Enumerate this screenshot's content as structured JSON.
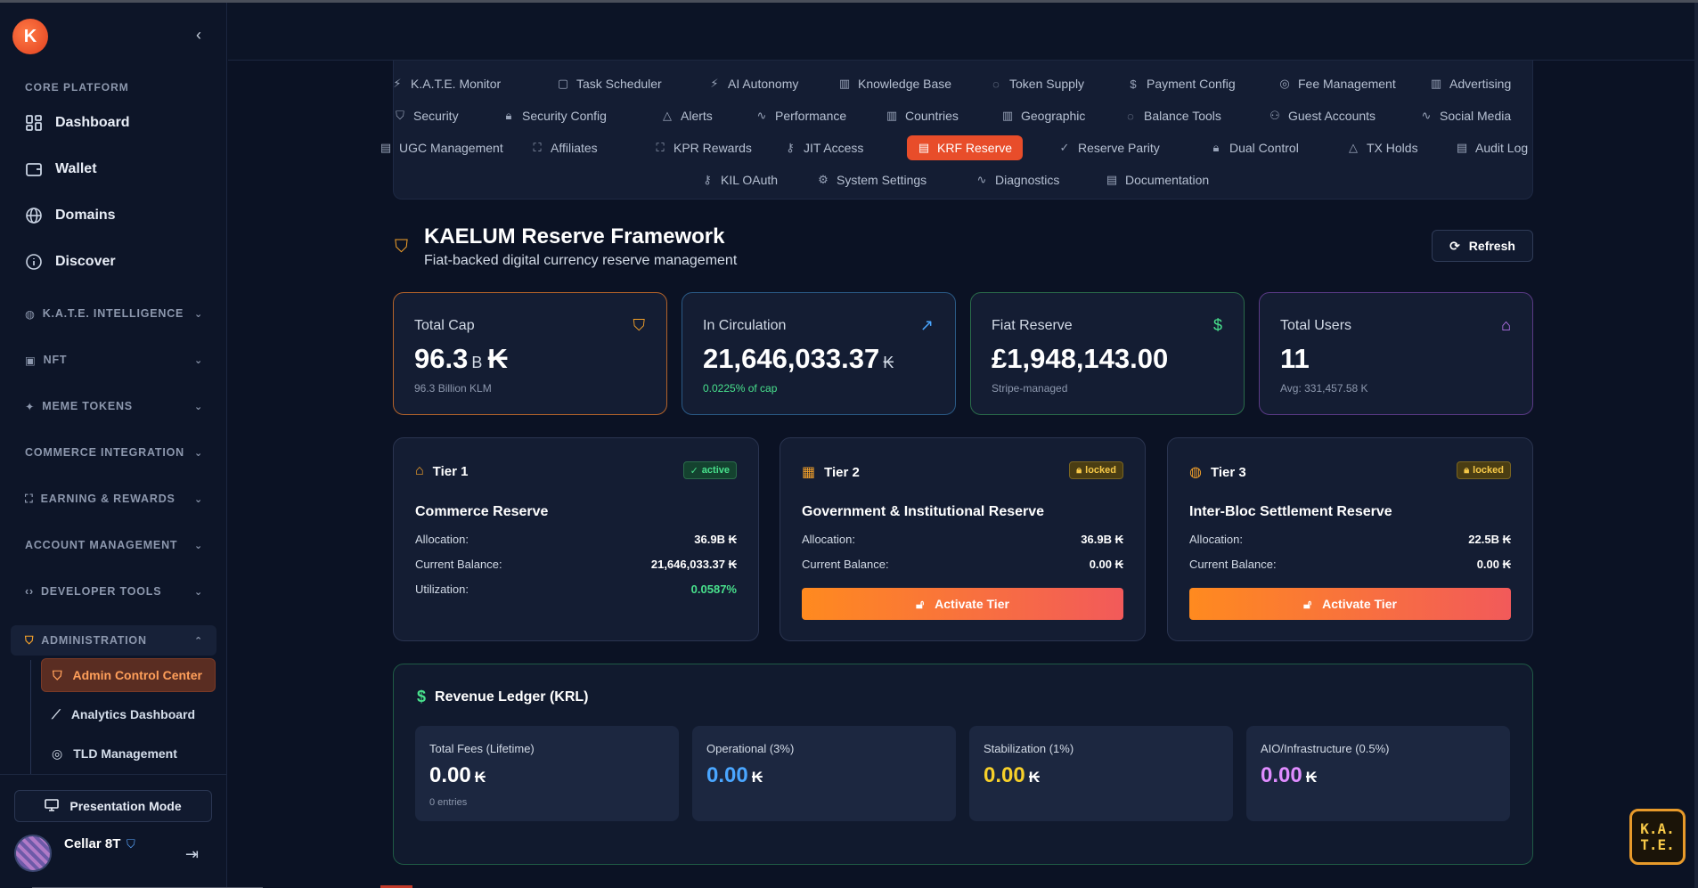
{
  "sidebar": {
    "core_label": "CORE PLATFORM",
    "core_items": [
      {
        "label": "Dashboard",
        "icon": "dashboard-icon"
      },
      {
        "label": "Wallet",
        "icon": "wallet-icon"
      },
      {
        "label": "Domains",
        "icon": "globe-icon"
      },
      {
        "label": "Discover",
        "icon": "info-icon"
      }
    ],
    "groups": [
      {
        "label": "K.A.T.E. INTELLIGENCE",
        "icon": "brain-icon"
      },
      {
        "label": "NFT",
        "icon": "image-icon"
      },
      {
        "label": "MEME TOKENS",
        "icon": "sparkle-icon"
      },
      {
        "label": "COMMERCE INTEGRATION",
        "icon": ""
      },
      {
        "label": "EARNING & REWARDS",
        "icon": "gift-icon"
      },
      {
        "label": "ACCOUNT MANAGEMENT",
        "icon": ""
      },
      {
        "label": "DEVELOPER TOOLS",
        "icon": "code-icon"
      },
      {
        "label": "ADMINISTRATION",
        "icon": "shield-icon"
      }
    ],
    "admin_items": [
      {
        "label": "Admin Control Center",
        "icon": "shield-icon"
      },
      {
        "label": "Analytics Dashboard",
        "icon": "trend-icon"
      },
      {
        "label": "TLD Management",
        "icon": "globe-icon"
      }
    ],
    "presentation_label": "Presentation Mode",
    "user_name": "Cellar 8T"
  },
  "tabs": [
    [
      "K.A.T.E. Monitor",
      "Task Scheduler",
      "AI Autonomy",
      "Knowledge Base",
      "Token Supply",
      "Payment Config",
      "Fee Management",
      "Advertising"
    ],
    [
      "Security",
      "Security Config",
      "Alerts",
      "Performance",
      "Countries",
      "Geographic",
      "Balance Tools",
      "Guest Accounts",
      "Social Media"
    ],
    [
      "UGC Management",
      "Affiliates",
      "KPR Rewards",
      "JIT Access",
      "KRF Reserve",
      "Reserve Parity",
      "Dual Control",
      "TX Holds",
      "Audit Log"
    ],
    [
      "KIL OAuth",
      "System Settings",
      "Diagnostics",
      "Documentation"
    ]
  ],
  "active_tab": "KRF Reserve",
  "header": {
    "title": "KAELUM Reserve Framework",
    "subtitle": "Fiat-backed digital currency reserve management",
    "refresh_label": "Refresh"
  },
  "stats": [
    {
      "label": "Total Cap",
      "value": "96.3",
      "unit": "B",
      "currency": "₭",
      "sub": "96.3 Billion KLM",
      "border": "#b4632a",
      "icon_color": "#f4a12a"
    },
    {
      "label": "In Circulation",
      "value": "21,646,033.37",
      "unit": "",
      "currency": "₭",
      "sub": "0.0225% of cap",
      "border": "#2a5a86",
      "icon_color": "#4aa6ff"
    },
    {
      "label": "Fiat Reserve",
      "value": "£1,948,143.00",
      "unit": "",
      "currency": "",
      "sub": "Stripe-managed",
      "border": "#2a6b4a",
      "icon_color": "#48e08c"
    },
    {
      "label": "Total Users",
      "value": "11",
      "unit": "",
      "currency": "",
      "sub": "Avg: 331,457.58 K",
      "border": "#5a3a86",
      "icon_color": "#c77dff"
    }
  ],
  "tiers": [
    {
      "tier": "Tier 1",
      "status": "active",
      "name": "Commerce Reserve",
      "allocation_label": "Allocation:",
      "allocation": "36.9B ₭",
      "balance_label": "Current Balance:",
      "balance": "21,646,033.37 ₭",
      "util_label": "Utilization:",
      "utilization": "0.0587%"
    },
    {
      "tier": "Tier 2",
      "status": "locked",
      "name": "Government & Institutional Reserve",
      "allocation_label": "Allocation:",
      "allocation": "36.9B ₭",
      "balance_label": "Current Balance:",
      "balance": "0.00 ₭",
      "button": "Activate Tier"
    },
    {
      "tier": "Tier 3",
      "status": "locked",
      "name": "Inter-Bloc Settlement Reserve",
      "allocation_label": "Allocation:",
      "allocation": "22.5B ₭",
      "balance_label": "Current Balance:",
      "balance": "0.00 ₭",
      "button": "Activate Tier"
    }
  ],
  "ledger": {
    "title": "Revenue Ledger (KRL)",
    "boxes": [
      {
        "label": "Total Fees (Lifetime)",
        "value": "0.00",
        "currency": "₭",
        "sub": "0 entries",
        "color": "#ffffff"
      },
      {
        "label": "Operational (3%)",
        "value": "0.00",
        "currency": "₭",
        "sub": "",
        "color": "#4aa6ff"
      },
      {
        "label": "Stabilization (1%)",
        "value": "0.00",
        "currency": "₭",
        "sub": "",
        "color": "#f7d02a"
      },
      {
        "label": "AIO/Infrastructure (0.5%)",
        "value": "0.00",
        "currency": "₭",
        "sub": "",
        "color": "#e08cff"
      }
    ]
  },
  "kate_badge": "K.A.\nT.E."
}
